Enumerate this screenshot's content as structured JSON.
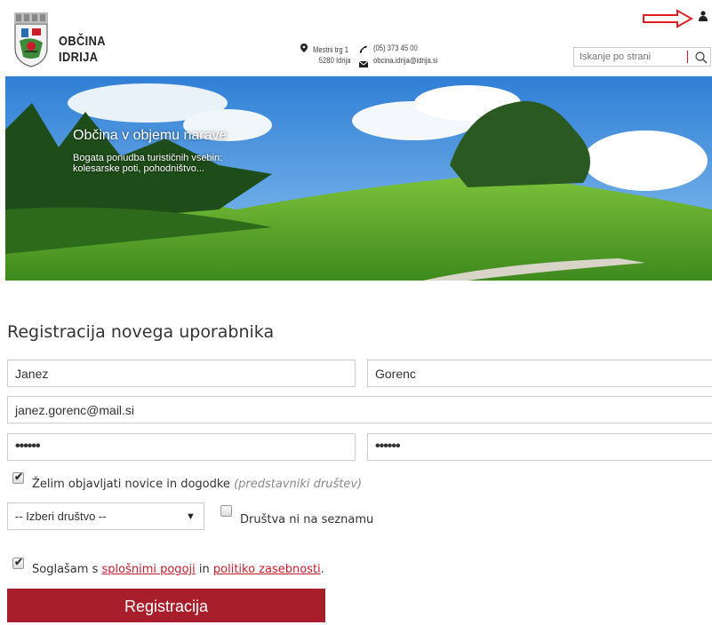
{
  "header": {
    "brand_line1": "OBČINA",
    "brand_line2": "IDRIJA",
    "address_line1": "Mestni trg 1",
    "address_line2": "5280 Idrija",
    "phone": "(05) 373 45 00",
    "email": "obcina.idrija@idrija.si",
    "search_placeholder": "Iskanje po strani"
  },
  "hero": {
    "title": "Občina v objemu narave",
    "subtitle_line1": "Bogata ponudba turističnih vsebin:",
    "subtitle_line2": "kolesarske poti, pohodništvo..."
  },
  "form": {
    "title": "Registracija novega uporabnika",
    "first_name": "Janez",
    "last_name": "Gorenc",
    "email": "janez.gorenc@mail.si",
    "password": "••••••",
    "password_repeat": "••••••",
    "news_label": "Želim objavljati novice in dogodke",
    "news_note": "(predstavniki društev)",
    "news_checked": true,
    "society_select": "-- Izberi društvo --",
    "society_missing_label": "Društva ni na seznamu",
    "society_missing_checked": false,
    "terms_prefix": "Soglašam s",
    "terms_link": "splošnimi pogoji",
    "terms_mid": "in",
    "privacy_link": "politiko zasebnosti",
    "terms_suffix": ".",
    "terms_checked": true,
    "submit": "Registracija"
  },
  "colors": {
    "accent": "#c81e2b",
    "button": "#a81e2a"
  },
  "icons": [
    "crest-logo-icon",
    "map-marker-icon",
    "phone-icon",
    "envelope-icon",
    "search-icon",
    "user-icon",
    "red-arrow-icon",
    "checkbox-icon",
    "dropdown-caret-icon"
  ]
}
